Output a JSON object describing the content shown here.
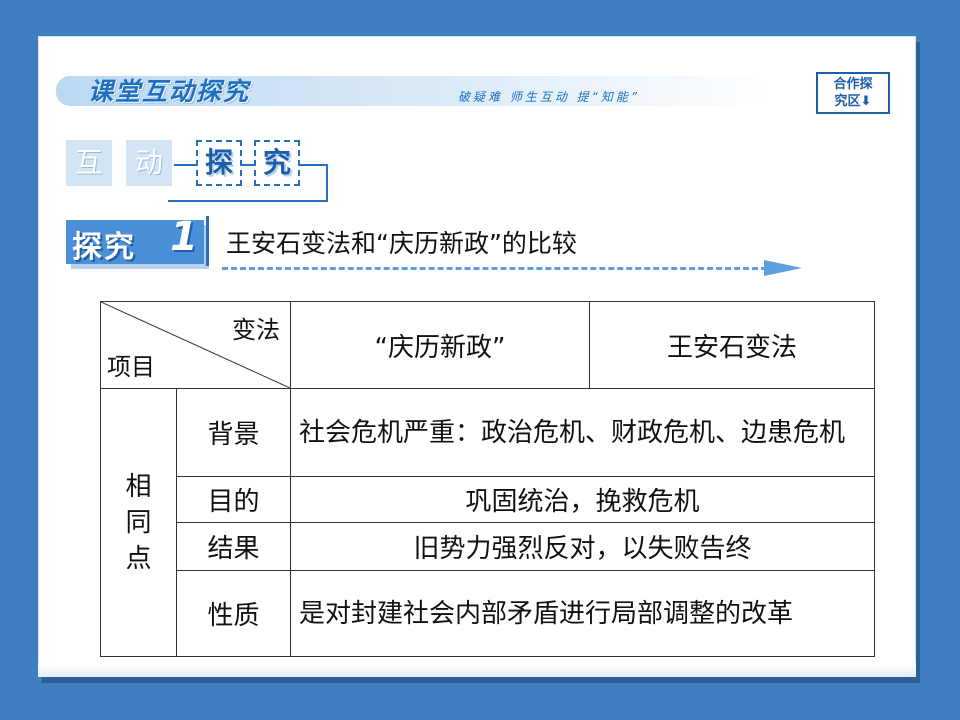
{
  "header": {
    "title": "课堂互动探究",
    "subtitle": "破疑难 师生互动 提“知能”",
    "badge_line1": "合作探",
    "badge_line2": "究区⬇"
  },
  "banner": {
    "chars": [
      "互",
      "动",
      "探",
      "究"
    ]
  },
  "section": {
    "label": "探究",
    "number": "1",
    "title": "王安石变法和“庆历新政”的比较"
  },
  "table": {
    "corner_top": "变法",
    "corner_bottom": "项目",
    "col1": "“庆历新政”",
    "col2": "王安石变法",
    "group": [
      "相",
      "同",
      "点"
    ],
    "rows": [
      {
        "label": "背景",
        "text": "社会危机严重：政治危机、财政危机、边患危机"
      },
      {
        "label": "目的",
        "text": "巩固统治，挽救危机"
      },
      {
        "label": "结果",
        "text": "旧势力强烈反对，以失败告终"
      },
      {
        "label": "性质",
        "text": "是对封建社会内部矛盾进行局部调整的改革"
      }
    ]
  }
}
